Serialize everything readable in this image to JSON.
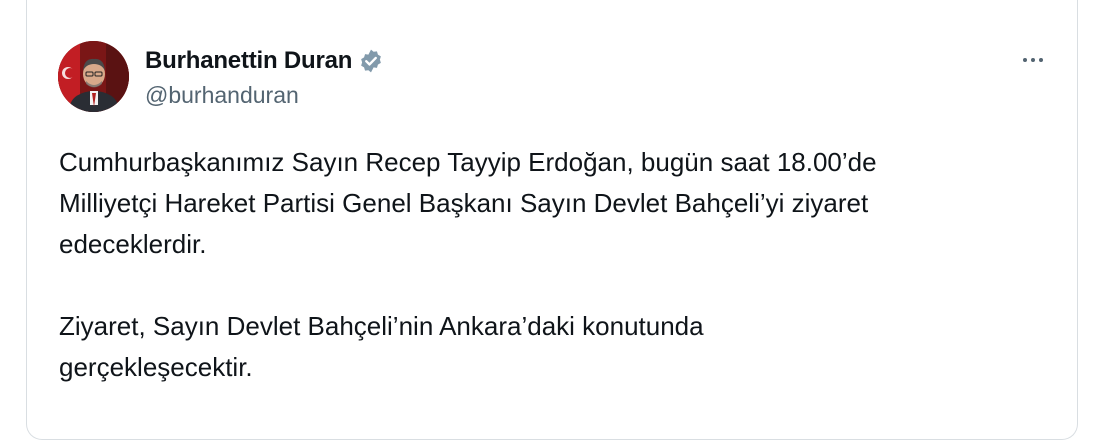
{
  "author": {
    "display_name": "Burhanettin Duran",
    "handle": "@burhanduran",
    "verified": true,
    "avatar": "avatar-portrait"
  },
  "actions": {
    "more_icon": "more-horizontal-icon"
  },
  "tweet": {
    "lines_paragraph_1": [
      "Cumhurbaşkanımız Sayın Recep Tayyip Erdoğan, bugün saat 18.00’de",
      "Milliyetçi Hareket Partisi Genel Başkanı Sayın Devlet Bahçeli’yi ziyaret",
      "edeceklerdir."
    ],
    "lines_paragraph_2": [
      "Ziyaret, Sayın Devlet Bahçeli’nin Ankara’daki konutunda",
      "gerçekleşecektir."
    ]
  },
  "colors": {
    "text_primary": "#0f1419",
    "text_secondary": "#536471",
    "verified_badge": "#829aab",
    "border": "#d9dee2"
  }
}
